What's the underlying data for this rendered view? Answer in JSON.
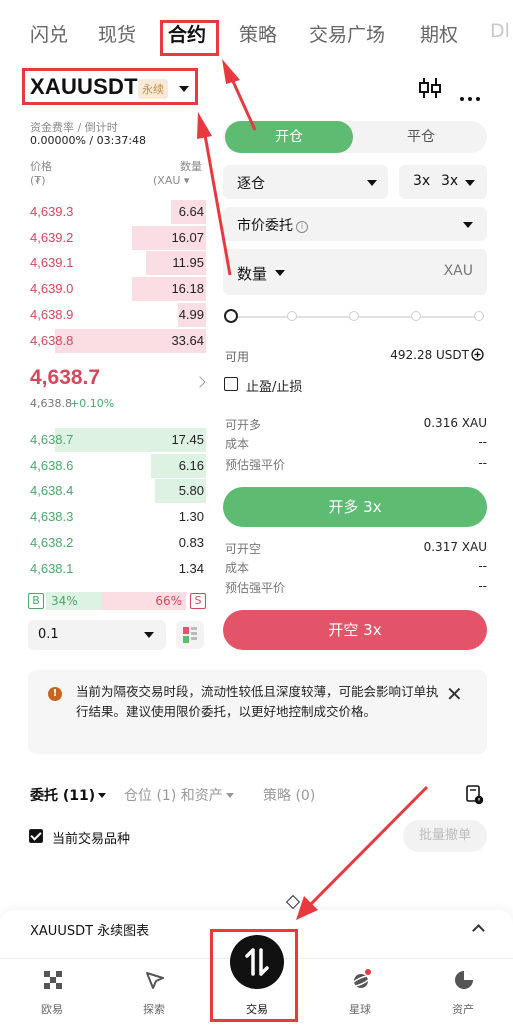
{
  "top_tabs": [
    "闪兑",
    "现货",
    "合约",
    "策略",
    "交易广场",
    "期权",
    "Dl"
  ],
  "symbol": {
    "name": "XAUUSDT",
    "badge": "永续"
  },
  "funding": {
    "label": "资金费率 / 倒计时",
    "value": "0.00000% / 03:37:48"
  },
  "orderbook": {
    "price_label": "价格",
    "price_unit": "(₮)",
    "qty_label": "数量",
    "qty_unit": "(XAU ▾",
    "asks": [
      {
        "price": "4,639.3",
        "qty": "6.64",
        "depth": 0.2
      },
      {
        "price": "4,639.2",
        "qty": "16.07",
        "depth": 0.42
      },
      {
        "price": "4,639.1",
        "qty": "11.95",
        "depth": 0.34
      },
      {
        "price": "4,639.0",
        "qty": "16.18",
        "depth": 0.42
      },
      {
        "price": "4,638.9",
        "qty": "4.99",
        "depth": 0.16
      },
      {
        "price": "4,638.8",
        "qty": "33.64",
        "depth": 0.86
      }
    ],
    "last_price": "4,638.7",
    "mark_price": "4,638.8",
    "change": "+0.10%",
    "bids": [
      {
        "price": "4,638.7",
        "qty": "17.45",
        "depth": 0.86
      },
      {
        "price": "4,638.6",
        "qty": "6.16",
        "depth": 0.31
      },
      {
        "price": "4,638.4",
        "qty": "5.80",
        "depth": 0.29
      },
      {
        "price": "4,638.3",
        "qty": "1.30",
        "depth": 0.0
      },
      {
        "price": "4,638.2",
        "qty": "0.83",
        "depth": 0.0
      },
      {
        "price": "4,638.1",
        "qty": "1.34",
        "depth": 0.0
      }
    ],
    "buy_ratio": {
      "tag": "B",
      "pct": "34%"
    },
    "sell_ratio": {
      "tag": "S",
      "pct": "66%"
    },
    "depth_step": "0.1"
  },
  "order_form": {
    "open_tab": "开仓",
    "close_tab": "平仓",
    "margin_mode": "逐仓",
    "leverage_long": "3x",
    "leverage_short": "3x",
    "order_type": "市价委托",
    "qty_label": "数量",
    "qty_unit": "XAU",
    "available_label": "可用",
    "available_value": "492.28 USDT",
    "tp_sl_label": "止盈/止损",
    "long": {
      "max_label": "可开多",
      "max_value": "0.316 XAU",
      "cost_label": "成本",
      "cost_value": "--",
      "liq_label": "预估强平价",
      "liq_value": "--",
      "button": "开多 3x"
    },
    "short": {
      "max_label": "可开空",
      "max_value": "0.317 XAU",
      "cost_label": "成本",
      "cost_value": "--",
      "liq_label": "预估强平价",
      "liq_value": "--",
      "button": "开空 3x"
    }
  },
  "notice": {
    "text": "当前为隔夜交易时段，流动性较低且深度较薄，可能会影响订单执行结果。建议使用限价委托，以更好地控制成交价格。"
  },
  "orders": {
    "tabs": [
      {
        "label": "委托 (11)"
      },
      {
        "label": "仓位 (1) 和资产"
      },
      {
        "label": "策略 (0)"
      }
    ],
    "current_only": "当前交易品种",
    "batch_cancel": "批量撤单"
  },
  "drawer": {
    "title": "XAUUSDT 永续图表"
  },
  "nav": [
    "欧易",
    "探索",
    "交易",
    "星球",
    "资产"
  ],
  "colors": {
    "green": "#5dbb72",
    "red": "#e35468",
    "highlight": "#e8393f"
  }
}
